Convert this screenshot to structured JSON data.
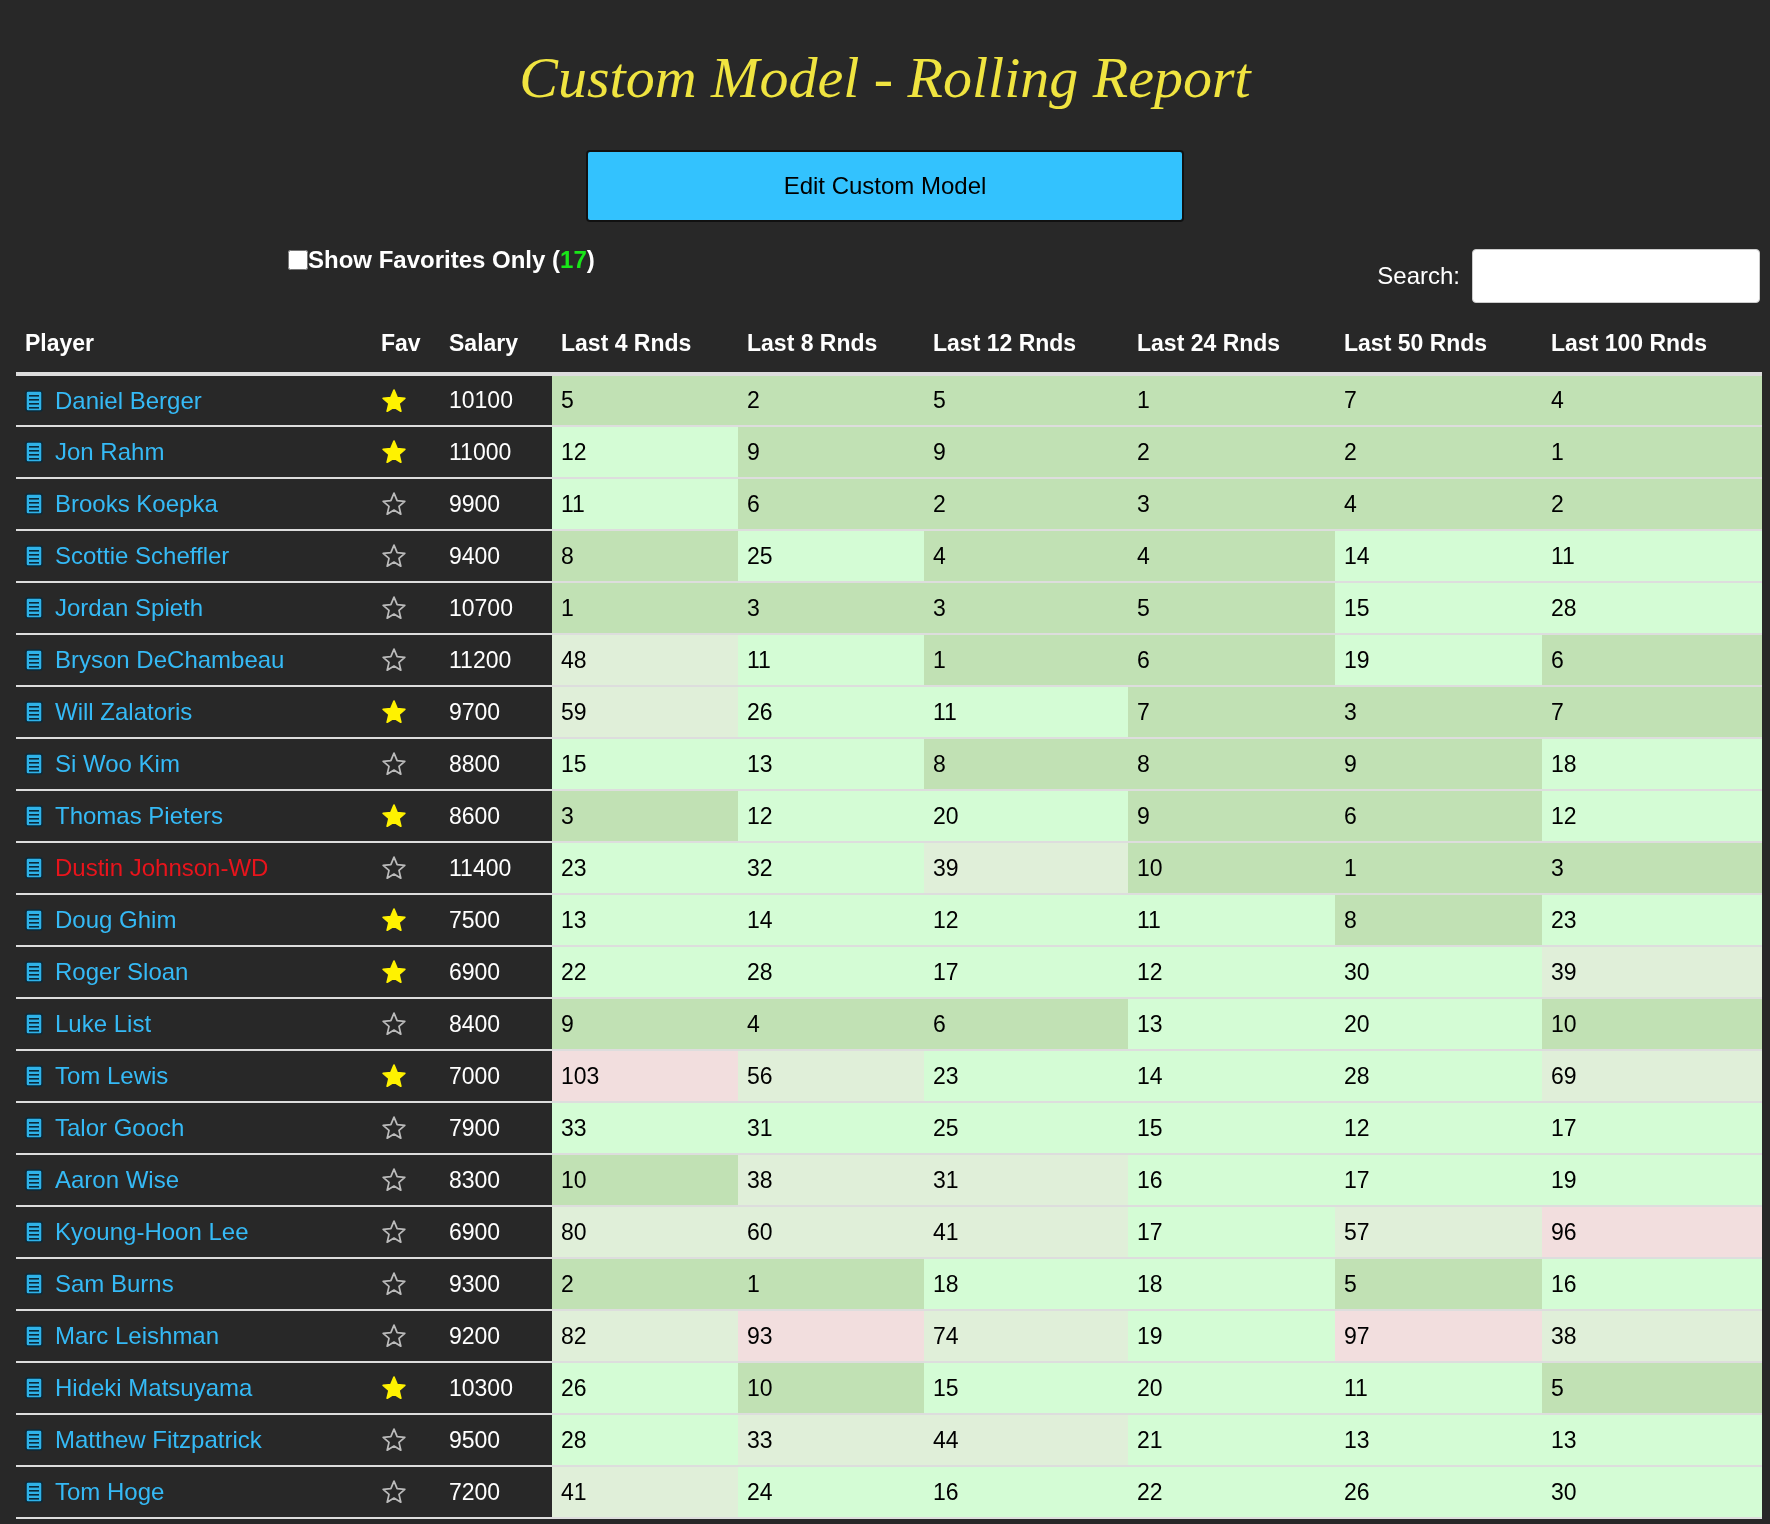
{
  "title": "Custom Model - Rolling Report",
  "edit_button": "Edit Custom Model",
  "favorites_filter": {
    "checked": false,
    "label": "Show Favorites Only",
    "count": "17",
    "count_open": "(",
    "count_close": ")"
  },
  "search": {
    "label": "Search:"
  },
  "table": {
    "columns": [
      "Player",
      "Fav",
      "Salary",
      "Last 4 Rnds",
      "Last 8 Rnds",
      "Last 12 Rnds",
      "Last 24 Rnds",
      "Last 50 Rnds",
      "Last 100 Rnds"
    ],
    "rows": [
      {
        "player": "Daniel Berger",
        "withdrawn": false,
        "favorite": true,
        "salary": "10100",
        "ranks": [
          {
            "value": "5",
            "color": "#c1e1b4"
          },
          {
            "value": "2",
            "color": "#c1e1b4"
          },
          {
            "value": "5",
            "color": "#c1e1b4"
          },
          {
            "value": "1",
            "color": "#c1e1b4"
          },
          {
            "value": "7",
            "color": "#c1e1b4"
          },
          {
            "value": "4",
            "color": "#c1e1b4"
          }
        ]
      },
      {
        "player": "Jon Rahm",
        "withdrawn": false,
        "favorite": true,
        "salary": "11000",
        "ranks": [
          {
            "value": "12",
            "color": "#d4fcd5"
          },
          {
            "value": "9",
            "color": "#c1e1b4"
          },
          {
            "value": "9",
            "color": "#c1e1b4"
          },
          {
            "value": "2",
            "color": "#c1e1b4"
          },
          {
            "value": "2",
            "color": "#c1e1b4"
          },
          {
            "value": "1",
            "color": "#c1e1b4"
          }
        ]
      },
      {
        "player": "Brooks Koepka",
        "withdrawn": false,
        "favorite": false,
        "salary": "9900",
        "ranks": [
          {
            "value": "11",
            "color": "#d4fcd5"
          },
          {
            "value": "6",
            "color": "#c1e1b4"
          },
          {
            "value": "2",
            "color": "#c1e1b4"
          },
          {
            "value": "3",
            "color": "#c1e1b4"
          },
          {
            "value": "4",
            "color": "#c1e1b4"
          },
          {
            "value": "2",
            "color": "#c1e1b4"
          }
        ]
      },
      {
        "player": "Scottie Scheffler",
        "withdrawn": false,
        "favorite": false,
        "salary": "9400",
        "ranks": [
          {
            "value": "8",
            "color": "#c1e1b4"
          },
          {
            "value": "25",
            "color": "#d4fcd5"
          },
          {
            "value": "4",
            "color": "#c1e1b4"
          },
          {
            "value": "4",
            "color": "#c1e1b4"
          },
          {
            "value": "14",
            "color": "#d4fcd5"
          },
          {
            "value": "11",
            "color": "#d4fcd5"
          }
        ]
      },
      {
        "player": "Jordan Spieth",
        "withdrawn": false,
        "favorite": false,
        "salary": "10700",
        "ranks": [
          {
            "value": "1",
            "color": "#c1e1b4"
          },
          {
            "value": "3",
            "color": "#c1e1b4"
          },
          {
            "value": "3",
            "color": "#c1e1b4"
          },
          {
            "value": "5",
            "color": "#c1e1b4"
          },
          {
            "value": "15",
            "color": "#d4fcd5"
          },
          {
            "value": "28",
            "color": "#d4fcd5"
          }
        ]
      },
      {
        "player": "Bryson DeChambeau",
        "withdrawn": false,
        "favorite": false,
        "salary": "11200",
        "ranks": [
          {
            "value": "48",
            "color": "#e0efd9"
          },
          {
            "value": "11",
            "color": "#d4fcd5"
          },
          {
            "value": "1",
            "color": "#c1e1b4"
          },
          {
            "value": "6",
            "color": "#c1e1b4"
          },
          {
            "value": "19",
            "color": "#d4fcd5"
          },
          {
            "value": "6",
            "color": "#c1e1b4"
          }
        ]
      },
      {
        "player": "Will Zalatoris",
        "withdrawn": false,
        "favorite": true,
        "salary": "9700",
        "ranks": [
          {
            "value": "59",
            "color": "#e0efd9"
          },
          {
            "value": "26",
            "color": "#d4fcd5"
          },
          {
            "value": "11",
            "color": "#d4fcd5"
          },
          {
            "value": "7",
            "color": "#c1e1b4"
          },
          {
            "value": "3",
            "color": "#c1e1b4"
          },
          {
            "value": "7",
            "color": "#c1e1b4"
          }
        ]
      },
      {
        "player": "Si Woo Kim",
        "withdrawn": false,
        "favorite": false,
        "salary": "8800",
        "ranks": [
          {
            "value": "15",
            "color": "#d4fcd5"
          },
          {
            "value": "13",
            "color": "#d4fcd5"
          },
          {
            "value": "8",
            "color": "#c1e1b4"
          },
          {
            "value": "8",
            "color": "#c1e1b4"
          },
          {
            "value": "9",
            "color": "#c1e1b4"
          },
          {
            "value": "18",
            "color": "#d4fcd5"
          }
        ]
      },
      {
        "player": "Thomas Pieters",
        "withdrawn": false,
        "favorite": true,
        "salary": "8600",
        "ranks": [
          {
            "value": "3",
            "color": "#c1e1b4"
          },
          {
            "value": "12",
            "color": "#d4fcd5"
          },
          {
            "value": "20",
            "color": "#d4fcd5"
          },
          {
            "value": "9",
            "color": "#c1e1b4"
          },
          {
            "value": "6",
            "color": "#c1e1b4"
          },
          {
            "value": "12",
            "color": "#d4fcd5"
          }
        ]
      },
      {
        "player": "Dustin Johnson-WD",
        "withdrawn": true,
        "favorite": false,
        "salary": "11400",
        "ranks": [
          {
            "value": "23",
            "color": "#d4fcd5"
          },
          {
            "value": "32",
            "color": "#d4fcd5"
          },
          {
            "value": "39",
            "color": "#e0efd9"
          },
          {
            "value": "10",
            "color": "#c1e1b4"
          },
          {
            "value": "1",
            "color": "#c1e1b4"
          },
          {
            "value": "3",
            "color": "#c1e1b4"
          }
        ]
      },
      {
        "player": "Doug Ghim",
        "withdrawn": false,
        "favorite": true,
        "salary": "7500",
        "ranks": [
          {
            "value": "13",
            "color": "#d4fcd5"
          },
          {
            "value": "14",
            "color": "#d4fcd5"
          },
          {
            "value": "12",
            "color": "#d4fcd5"
          },
          {
            "value": "11",
            "color": "#d4fcd5"
          },
          {
            "value": "8",
            "color": "#c1e1b4"
          },
          {
            "value": "23",
            "color": "#d4fcd5"
          }
        ]
      },
      {
        "player": "Roger Sloan",
        "withdrawn": false,
        "favorite": true,
        "salary": "6900",
        "ranks": [
          {
            "value": "22",
            "color": "#d4fcd5"
          },
          {
            "value": "28",
            "color": "#d4fcd5"
          },
          {
            "value": "17",
            "color": "#d4fcd5"
          },
          {
            "value": "12",
            "color": "#d4fcd5"
          },
          {
            "value": "30",
            "color": "#d4fcd5"
          },
          {
            "value": "39",
            "color": "#e0efd9"
          }
        ]
      },
      {
        "player": "Luke List",
        "withdrawn": false,
        "favorite": false,
        "salary": "8400",
        "ranks": [
          {
            "value": "9",
            "color": "#c1e1b4"
          },
          {
            "value": "4",
            "color": "#c1e1b4"
          },
          {
            "value": "6",
            "color": "#c1e1b4"
          },
          {
            "value": "13",
            "color": "#d4fcd5"
          },
          {
            "value": "20",
            "color": "#d4fcd5"
          },
          {
            "value": "10",
            "color": "#c1e1b4"
          }
        ]
      },
      {
        "player": "Tom Lewis",
        "withdrawn": false,
        "favorite": true,
        "salary": "7000",
        "ranks": [
          {
            "value": "103",
            "color": "#f2dede"
          },
          {
            "value": "56",
            "color": "#e0efd9"
          },
          {
            "value": "23",
            "color": "#d4fcd5"
          },
          {
            "value": "14",
            "color": "#d4fcd5"
          },
          {
            "value": "28",
            "color": "#d4fcd5"
          },
          {
            "value": "69",
            "color": "#e0efd9"
          }
        ]
      },
      {
        "player": "Talor Gooch",
        "withdrawn": false,
        "favorite": false,
        "salary": "7900",
        "ranks": [
          {
            "value": "33",
            "color": "#d4fcd5"
          },
          {
            "value": "31",
            "color": "#d4fcd5"
          },
          {
            "value": "25",
            "color": "#d4fcd5"
          },
          {
            "value": "15",
            "color": "#d4fcd5"
          },
          {
            "value": "12",
            "color": "#d4fcd5"
          },
          {
            "value": "17",
            "color": "#d4fcd5"
          }
        ]
      },
      {
        "player": "Aaron Wise",
        "withdrawn": false,
        "favorite": false,
        "salary": "8300",
        "ranks": [
          {
            "value": "10",
            "color": "#c1e1b4"
          },
          {
            "value": "38",
            "color": "#e0efd9"
          },
          {
            "value": "31",
            "color": "#e0efd9"
          },
          {
            "value": "16",
            "color": "#d4fcd5"
          },
          {
            "value": "17",
            "color": "#d4fcd5"
          },
          {
            "value": "19",
            "color": "#d4fcd5"
          }
        ]
      },
      {
        "player": "Kyoung-Hoon Lee",
        "withdrawn": false,
        "favorite": false,
        "salary": "6900",
        "ranks": [
          {
            "value": "80",
            "color": "#e0efd9"
          },
          {
            "value": "60",
            "color": "#e0efd9"
          },
          {
            "value": "41",
            "color": "#e0efd9"
          },
          {
            "value": "17",
            "color": "#d4fcd5"
          },
          {
            "value": "57",
            "color": "#e0efd9"
          },
          {
            "value": "96",
            "color": "#f2dede"
          }
        ]
      },
      {
        "player": "Sam Burns",
        "withdrawn": false,
        "favorite": false,
        "salary": "9300",
        "ranks": [
          {
            "value": "2",
            "color": "#c1e1b4"
          },
          {
            "value": "1",
            "color": "#c1e1b4"
          },
          {
            "value": "18",
            "color": "#d4fcd5"
          },
          {
            "value": "18",
            "color": "#d4fcd5"
          },
          {
            "value": "5",
            "color": "#c1e1b4"
          },
          {
            "value": "16",
            "color": "#d4fcd5"
          }
        ]
      },
      {
        "player": "Marc Leishman",
        "withdrawn": false,
        "favorite": false,
        "salary": "9200",
        "ranks": [
          {
            "value": "82",
            "color": "#e0efd9"
          },
          {
            "value": "93",
            "color": "#f2dede"
          },
          {
            "value": "74",
            "color": "#e0efd9"
          },
          {
            "value": "19",
            "color": "#d4fcd5"
          },
          {
            "value": "97",
            "color": "#f2dede"
          },
          {
            "value": "38",
            "color": "#e0efd9"
          }
        ]
      },
      {
        "player": "Hideki Matsuyama",
        "withdrawn": false,
        "favorite": true,
        "salary": "10300",
        "ranks": [
          {
            "value": "26",
            "color": "#d4fcd5"
          },
          {
            "value": "10",
            "color": "#c1e1b4"
          },
          {
            "value": "15",
            "color": "#d4fcd5"
          },
          {
            "value": "20",
            "color": "#d4fcd5"
          },
          {
            "value": "11",
            "color": "#d4fcd5"
          },
          {
            "value": "5",
            "color": "#c1e1b4"
          }
        ]
      },
      {
        "player": "Matthew Fitzpatrick",
        "withdrawn": false,
        "favorite": false,
        "salary": "9500",
        "ranks": [
          {
            "value": "28",
            "color": "#d4fcd5"
          },
          {
            "value": "33",
            "color": "#e0efd9"
          },
          {
            "value": "44",
            "color": "#e0efd9"
          },
          {
            "value": "21",
            "color": "#d4fcd5"
          },
          {
            "value": "13",
            "color": "#d4fcd5"
          },
          {
            "value": "13",
            "color": "#d4fcd5"
          }
        ]
      },
      {
        "player": "Tom Hoge",
        "withdrawn": false,
        "favorite": false,
        "salary": "7200",
        "ranks": [
          {
            "value": "41",
            "color": "#e0efd9"
          },
          {
            "value": "24",
            "color": "#d4fcd5"
          },
          {
            "value": "16",
            "color": "#d4fcd5"
          },
          {
            "value": "22",
            "color": "#d4fcd5"
          },
          {
            "value": "26",
            "color": "#d4fcd5"
          },
          {
            "value": "30",
            "color": "#d4fcd5"
          }
        ]
      }
    ]
  }
}
